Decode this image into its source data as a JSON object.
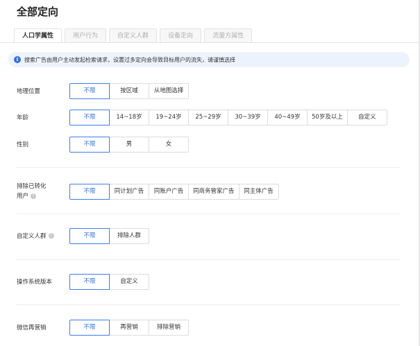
{
  "page": {
    "title": "全部定向"
  },
  "tabs": [
    {
      "label": "人口学属性",
      "active": true
    },
    {
      "label": "用户行为",
      "active": false
    },
    {
      "label": "自定义人群",
      "active": false
    },
    {
      "label": "设备定向",
      "active": false
    },
    {
      "label": "流量方属性",
      "active": false
    }
  ],
  "notice": {
    "icon": "info-icon",
    "text": "搜索广告由用户主动发起检索请求，设置过多定向会导致目标用户的流失，请谨慎选择"
  },
  "rows": {
    "geo": {
      "label": "地理位置",
      "options": [
        "不限",
        "按区域",
        "从地图选择"
      ],
      "selected": "不限"
    },
    "age": {
      "label": "年龄",
      "options": [
        "不限",
        "14~18岁",
        "19~24岁",
        "25~29岁",
        "30~39岁",
        "40~49岁",
        "50岁及以上",
        "自定义"
      ],
      "selected": "不限"
    },
    "gender": {
      "label": "性别",
      "options": [
        "不限",
        "男",
        "女"
      ],
      "selected": "不限"
    },
    "exclude": {
      "label_line1": "排除已转化",
      "label_line2": "用户",
      "options": [
        "不限",
        "同计划广告",
        "同账户广告",
        "同商务管家广告",
        "同主体广告"
      ],
      "selected": "不限"
    },
    "custom": {
      "label": "自定义人群",
      "options": [
        "不限",
        "排除人群"
      ],
      "selected": "不限"
    },
    "os": {
      "label": "操作系统版本",
      "options": [
        "不限",
        "自定义"
      ],
      "selected": "不限"
    },
    "wechat": {
      "label": "微信再营销",
      "options": [
        "不限",
        "再营销",
        "排除营销"
      ],
      "selected": "不限"
    }
  },
  "colors": {
    "accent": "#2f6fe0",
    "notice_bg": "#edf3fc"
  }
}
